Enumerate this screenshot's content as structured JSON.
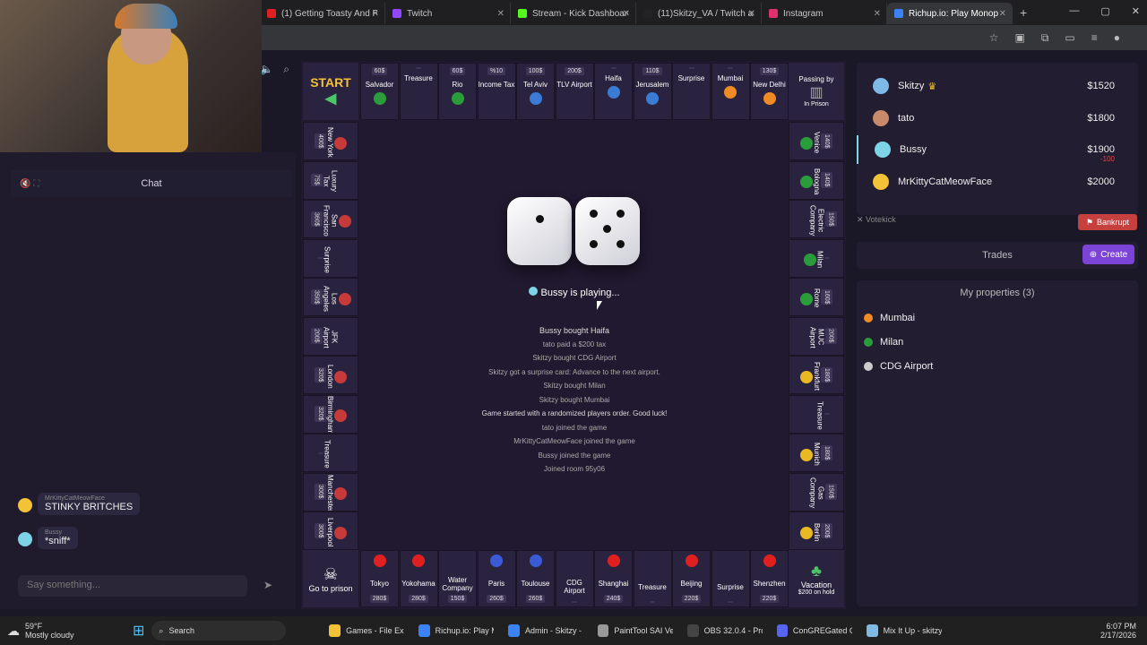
{
  "browser": {
    "tabs": [
      {
        "title": "(1) Getting Toasty And Ra",
        "color": "#e02020"
      },
      {
        "title": "Twitch",
        "color": "#9146ff"
      },
      {
        "title": "Stream - Kick Dashboard",
        "color": "#53fc18"
      },
      {
        "title": "(11)Skitzy_VA / Twitch and",
        "color": "#222222"
      },
      {
        "title": "Instagram",
        "color": "#e1306c"
      },
      {
        "title": "Richup.io: Play Monop",
        "color": "#3b82f6"
      }
    ]
  },
  "chat": {
    "title": "Chat",
    "messages": [
      {
        "user": "MrKittyCatMeowFace",
        "text": "STINKY BRITCHES",
        "color": "#f3c237"
      },
      {
        "user": "Bussy",
        "text": "*sniff*",
        "color": "#7fd3e6"
      }
    ],
    "placeholder": "Say something..."
  },
  "board": {
    "start_label": "START",
    "top_row": [
      {
        "name": "Salvador",
        "price": "60$",
        "flag": "#2a9d3a"
      },
      {
        "name": "Treasure",
        "price": "",
        "flag": ""
      },
      {
        "name": "Rio",
        "price": "60$",
        "flag": "#2a9d3a"
      },
      {
        "name": "Income Tax",
        "price": "%10",
        "flag": ""
      },
      {
        "name": "Tel Aviv",
        "price": "100$",
        "flag": "#3a7bd5"
      },
      {
        "name": "TLV Airport",
        "price": "200$",
        "flag": ""
      },
      {
        "name": "Haifa",
        "price": "",
        "flag": "#3a7bd5"
      },
      {
        "name": "Jerusalem",
        "price": "110$",
        "flag": "#3a7bd5"
      },
      {
        "name": "Surprise",
        "price": "",
        "flag": ""
      },
      {
        "name": "Mumbai",
        "price": "",
        "flag": "#f08a24"
      },
      {
        "name": "New Delhi",
        "price": "130$",
        "flag": "#f08a24"
      }
    ],
    "top_right_label": "Passing by",
    "in_prison": "In Prison",
    "right_col": [
      {
        "name": "Venice",
        "price": "140$",
        "flag": "#2a9d3a"
      },
      {
        "name": "Bologna",
        "price": "140$",
        "flag": "#2a9d3a"
      },
      {
        "name": "Electric Company",
        "price": "150$",
        "flag": ""
      },
      {
        "name": "Milan",
        "price": "",
        "flag": "#2a9d3a"
      },
      {
        "name": "Rome",
        "price": "160$",
        "flag": "#2a9d3a"
      },
      {
        "name": "MUC Airport",
        "price": "200$",
        "flag": ""
      },
      {
        "name": "Frankfurt",
        "price": "180$",
        "flag": "#e8b923"
      },
      {
        "name": "Treasure",
        "price": "",
        "flag": ""
      },
      {
        "name": "Munich",
        "price": "180$",
        "flag": "#e8b923"
      },
      {
        "name": "Gas Company",
        "price": "150$",
        "flag": ""
      },
      {
        "name": "Berlin",
        "price": "200$",
        "flag": "#e8b923"
      }
    ],
    "left_col": [
      {
        "name": "New York",
        "price": "400$",
        "flag": "#c73a3a"
      },
      {
        "name": "Luxury Tax",
        "price": "75$",
        "flag": ""
      },
      {
        "name": "San Francisco",
        "price": "360$",
        "flag": "#c73a3a"
      },
      {
        "name": "Surprise",
        "price": "",
        "flag": ""
      },
      {
        "name": "Los Angeles",
        "price": "350$",
        "flag": "#c73a3a"
      },
      {
        "name": "JFK Airport",
        "price": "200$",
        "flag": ""
      },
      {
        "name": "London",
        "price": "320$",
        "flag": "#c73a3a"
      },
      {
        "name": "Birmingham",
        "price": "320$",
        "flag": "#c73a3a"
      },
      {
        "name": "Treasure",
        "price": "",
        "flag": ""
      },
      {
        "name": "Manchester",
        "price": "300$",
        "flag": "#c73a3a"
      },
      {
        "name": "Liverpool",
        "price": "300$",
        "flag": "#c73a3a"
      }
    ],
    "bottom_row": [
      {
        "name": "Tokyo",
        "price": "280$",
        "flag": "#e02020"
      },
      {
        "name": "Yokohama",
        "price": "280$",
        "flag": "#e02020"
      },
      {
        "name": "Water Company",
        "price": "150$",
        "flag": ""
      },
      {
        "name": "Paris",
        "price": "260$",
        "flag": "#3a5bd5"
      },
      {
        "name": "Toulouse",
        "price": "260$",
        "flag": "#3a5bd5"
      },
      {
        "name": "CDG Airport",
        "price": "",
        "flag": ""
      },
      {
        "name": "Shanghai",
        "price": "240$",
        "flag": "#e02020"
      },
      {
        "name": "Treasure",
        "price": "",
        "flag": ""
      },
      {
        "name": "Beijing",
        "price": "220$",
        "flag": "#e02020"
      },
      {
        "name": "Surprise",
        "price": "",
        "flag": ""
      },
      {
        "name": "Shenzhen",
        "price": "220$",
        "flag": "#e02020"
      }
    ],
    "go_to_prison": "Go to prison",
    "vacation": "Vacation",
    "vacation_sub": "$200 on hold"
  },
  "game": {
    "status_player": "Bussy",
    "status_text": "is playing...",
    "log": [
      {
        "text": "Bussy  bought  Haifa",
        "hl": true
      },
      {
        "text": "tato  paid a $200 tax",
        "hl": false
      },
      {
        "text": "Skitzy  bought  CDG Airport",
        "hl": false
      },
      {
        "text": "Skitzy  got a surprise card: Advance to the next airport.",
        "hl": false
      },
      {
        "text": "Skitzy  bought  Milan",
        "hl": false
      },
      {
        "text": "Skitzy  bought  Mumbai",
        "hl": false
      },
      {
        "text": "Game started with a randomized players order. Good luck!",
        "hl": true
      },
      {
        "text": "tato  joined the game",
        "hl": false
      },
      {
        "text": "MrKittyCatMeowFace  joined the game",
        "hl": false
      },
      {
        "text": "Bussy  joined the game",
        "hl": false
      },
      {
        "text": "Joined room 95y06",
        "hl": false
      }
    ]
  },
  "players": [
    {
      "name": "Skitzy",
      "money": "$1520",
      "color": "#7fb9e6"
    },
    {
      "name": "tato",
      "money": "$1800",
      "color": "#c98a6b"
    },
    {
      "name": "Bussy",
      "money": "$1900",
      "delta": "-100",
      "color": "#7fd3e6"
    },
    {
      "name": "MrKittyCatMeowFace",
      "money": "$2000",
      "color": "#f3c237"
    }
  ],
  "actions": {
    "votekick": "Votekick",
    "bankrupt": "Bankrupt",
    "trades": "Trades",
    "create": "Create"
  },
  "my_properties": {
    "title": "My properties (3)",
    "items": [
      {
        "name": "Mumbai",
        "color": "#f08a24"
      },
      {
        "name": "Milan",
        "color": "#2a9d3a"
      },
      {
        "name": "CDG Airport",
        "color": "#cccccc"
      }
    ]
  },
  "taskbar": {
    "weather_temp": "59°F",
    "weather_desc": "Mostly cloudy",
    "search": "Search",
    "apps": [
      {
        "label": "Games - File Expl",
        "color": "#f3c237"
      },
      {
        "label": "Richup.io: Play Mo",
        "color": "#3b82f6"
      },
      {
        "label": "Admin - Skitzy - G",
        "color": "#3b82f6"
      },
      {
        "label": "PaintTool SAI Ver.2",
        "color": "#999999"
      },
      {
        "label": "OBS 32.0.4 - Profil",
        "color": "#444444"
      },
      {
        "label": "ConGREGated Cast",
        "color": "#5865f2"
      },
      {
        "label": "Mix It Up - skitzy_v",
        "color": "#7fb9e6"
      }
    ],
    "time": "6:07 PM",
    "date": "2/17/2026"
  }
}
